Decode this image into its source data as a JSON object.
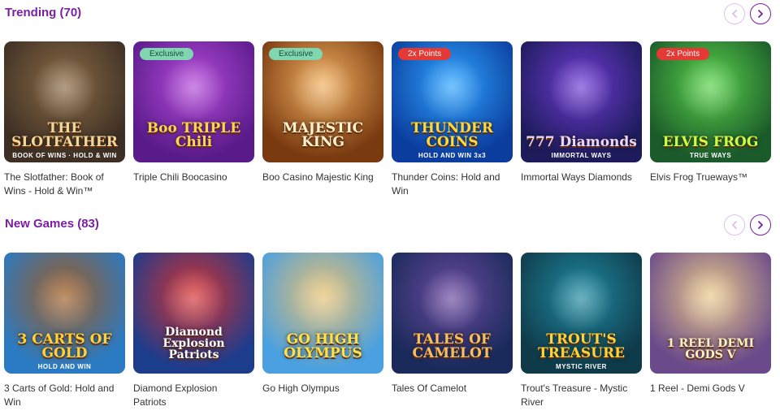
{
  "trending": {
    "title": "Trending (70)",
    "games": [
      {
        "name": "The Slotfather: Book of Wins - Hold & Win™",
        "art_title": "THE SLOTFATHER",
        "art_sub": "BOOK OF WINS · HOLD & WIN",
        "badge": "",
        "bg": "#3d2f24",
        "bg2": "#8a6a45",
        "text_color": "#f2d79a"
      },
      {
        "name": "Triple Chili Boocasino",
        "art_title": "Boo TRIPLE Chili",
        "art_sub": "",
        "badge": "Exclusive",
        "bg": "#5a1b8a",
        "bg2": "#b34ad8",
        "text_color": "#ffd64a"
      },
      {
        "name": "Boo Casino Majestic King",
        "art_title": "MAJESTIC KING",
        "art_sub": "",
        "badge": "Exclusive",
        "bg": "#7a3a10",
        "bg2": "#f0b060",
        "text_color": "#fff3d0"
      },
      {
        "name": "Thunder Coins: Hold and Win",
        "art_title": "THUNDER COINS",
        "art_sub": "HOLD AND WIN 3x3",
        "badge": "2x Points",
        "bg": "#0b3d9e",
        "bg2": "#2fa5ff",
        "text_color": "#ffd93a"
      },
      {
        "name": "Immortal Ways Diamonds",
        "art_title": "777 Diamonds",
        "art_sub": "IMMORTAL WAYS",
        "badge": "",
        "bg": "#1d1b5a",
        "bg2": "#6d3bd1",
        "text_color": "#e6d8ff"
      },
      {
        "name": "Elvis Frog Trueways™",
        "art_title": "ELVIS FROG",
        "art_sub": "TRUE WAYS",
        "badge": "2x Points",
        "bg": "#1b5a2a",
        "bg2": "#59d14a",
        "text_color": "#c9ff4a"
      }
    ]
  },
  "new_games": {
    "title": "New Games (83)",
    "games": [
      {
        "name": "3 Carts of Gold: Hold and Win",
        "art_title": "3 CARTS OF GOLD",
        "art_sub": "HOLD AND WIN",
        "badge": "",
        "bg": "#2a7bc4",
        "bg2": "#a05a1f",
        "text_color": "#ffd23a"
      },
      {
        "name": "Diamond Explosion Patriots",
        "art_title": "Diamond Explosion Patriots",
        "art_sub": "",
        "badge": "",
        "bg": "#1c3c8c",
        "bg2": "#d8322f",
        "text_color": "#ffffff"
      },
      {
        "name": "Go High Olympus",
        "art_title": "GO HIGH OLYMPUS",
        "art_sub": "",
        "badge": "",
        "bg": "#4aa0e0",
        "bg2": "#e8c070",
        "text_color": "#ffe14a"
      },
      {
        "name": "Tales Of Camelot",
        "art_title": "TALES OF CAMELOT",
        "art_sub": "",
        "badge": "",
        "bg": "#1a2a5a",
        "bg2": "#6a4aa0",
        "text_color": "#f5c060"
      },
      {
        "name": "Trout's Treasure - Mystic River",
        "art_title": "TROUT'S TREASURE",
        "art_sub": "MYSTIC RIVER",
        "badge": "",
        "bg": "#0f3a4a",
        "bg2": "#1f8aa0",
        "text_color": "#ffd23a"
      },
      {
        "name": "1 Reel - Demi Gods V",
        "art_title": "1 REEL DEMI GODS V",
        "art_sub": "",
        "badge": "",
        "bg": "#6a4a8a",
        "bg2": "#e8c98a",
        "text_color": "#fff2c0"
      }
    ]
  },
  "icons": {
    "prev": "chevron-left-icon",
    "next": "chevron-right-icon"
  },
  "colors": {
    "accent": "#7b1fa2",
    "badge_exclusive": "#7fd6b0",
    "badge_points": "#e53935"
  }
}
